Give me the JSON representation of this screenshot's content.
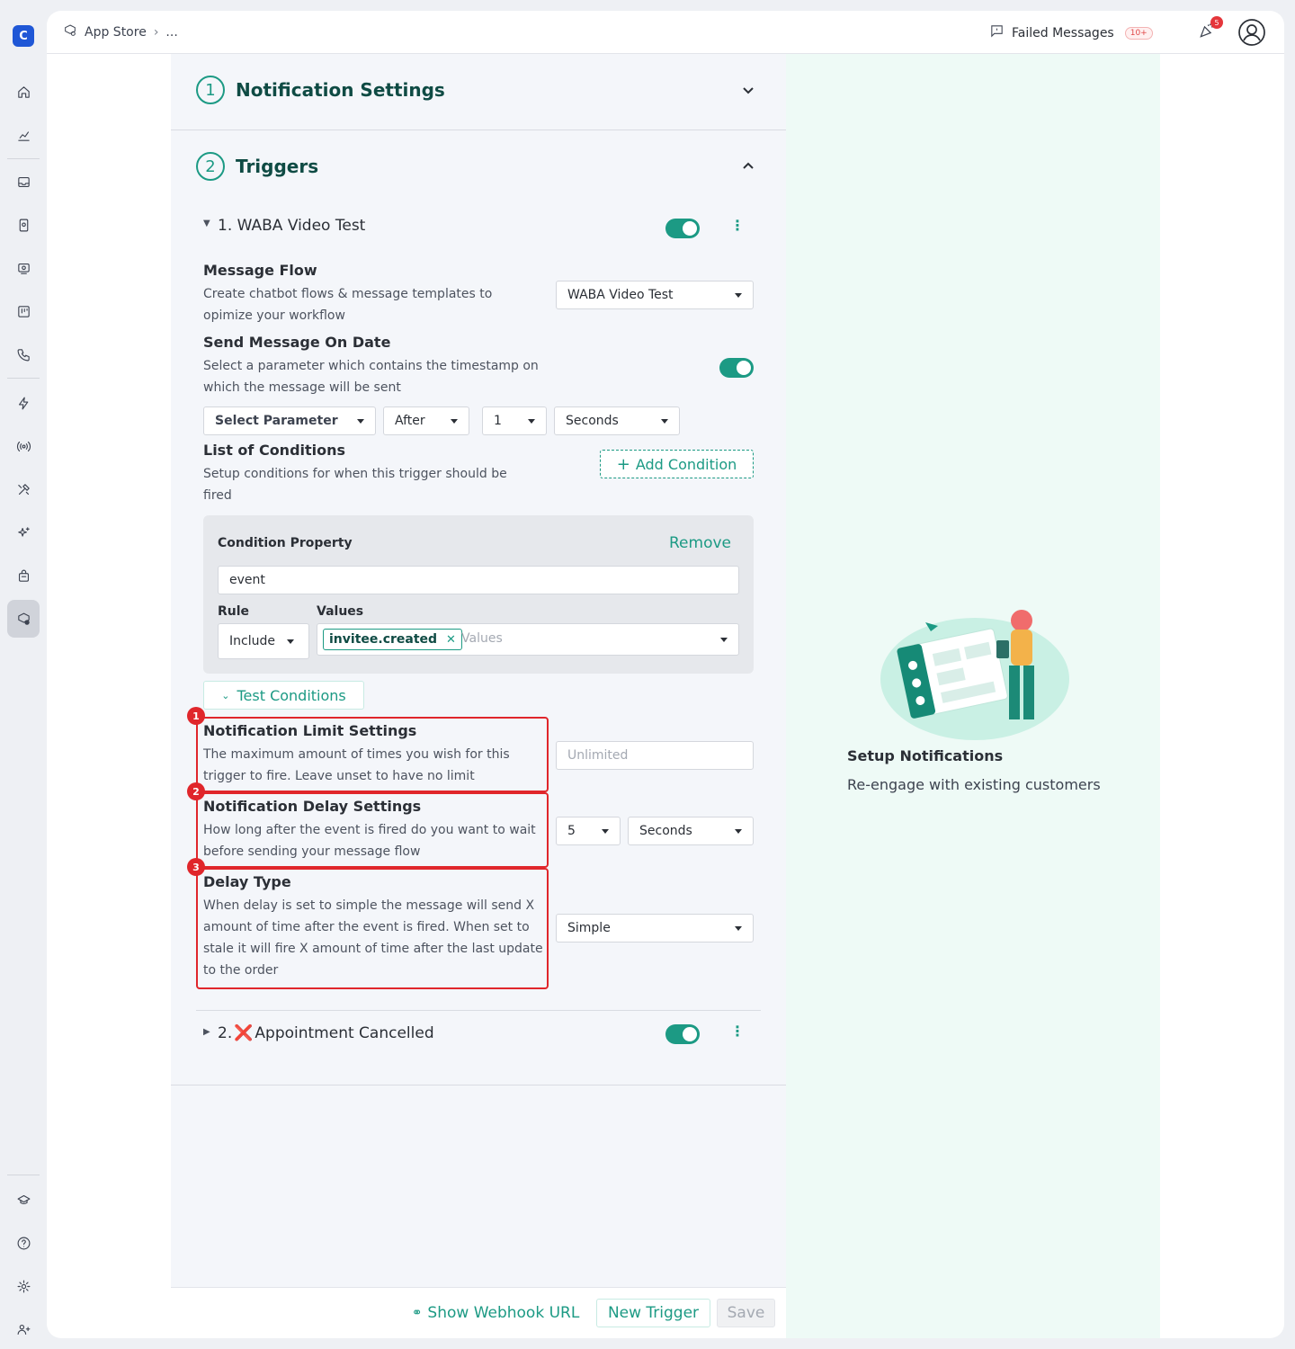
{
  "topbar": {
    "breadcrumb_root": "App Store",
    "breadcrumb_more": "...",
    "failed_messages": "Failed Messages",
    "failed_count": "10+",
    "notification_count": "5"
  },
  "sections": {
    "notification_settings": {
      "number": "1",
      "title": "Notification Settings"
    },
    "triggers": {
      "number": "2",
      "title": "Triggers"
    }
  },
  "trigger1": {
    "title": "1. WABA Video Test",
    "message_flow": {
      "heading": "Message Flow",
      "desc_line1": "Create chatbot flows & message templates to",
      "desc_line2": "opimize your workflow",
      "value": "WABA Video Test"
    },
    "send_on_date": {
      "heading": "Send Message On Date",
      "desc_line1": "Select a parameter which contains the timestamp on",
      "desc_line2": "which the message will be sent",
      "param": "Select Parameter",
      "when": "After",
      "amount": "1",
      "unit": "Seconds"
    },
    "conditions": {
      "heading": "List of Conditions",
      "desc_line1": "Setup conditions for when this trigger should be",
      "desc_line2": "fired",
      "add_label": "Add Condition",
      "property_label": "Condition Property",
      "remove_label": "Remove",
      "property_value": "event",
      "rule_label": "Rule",
      "values_label": "Values",
      "rule_value": "Include",
      "tag": "invitee.created",
      "values_placeholder": "Values"
    },
    "test_conditions": "Test Conditions",
    "limit": {
      "badge": "1",
      "heading": "Notification Limit Settings",
      "desc_line1": "The maximum amount of times you wish for this",
      "desc_line2": "trigger to fire. Leave unset to have no limit",
      "placeholder": "Unlimited"
    },
    "delay": {
      "badge": "2",
      "heading": "Notification Delay Settings",
      "desc_line1": "How long after the event is fired do you want to wait",
      "desc_line2": "before sending your message flow",
      "amount": "5",
      "unit": "Seconds"
    },
    "delay_type": {
      "badge": "3",
      "heading": "Delay Type",
      "desc_line1": "When delay is set to simple the message will send X",
      "desc_line2": "amount of time after the event is fired. When set to",
      "desc_line3": "stale it will fire X amount of time after the last update",
      "desc_line4": "to the order",
      "value": "Simple"
    }
  },
  "trigger2": {
    "prefix": "2.",
    "icon": "❌",
    "title": "Appointment Cancelled"
  },
  "footer": {
    "webhook": "Show Webhook URL",
    "new_trigger": "New Trigger",
    "save": "Save"
  },
  "right_panel": {
    "title": "Setup Notifications",
    "subtitle": "Re-engage with existing customers"
  },
  "colors": {
    "accent": "#1c9a84",
    "highlight": "#e0262b",
    "brand": "#1f57d6"
  }
}
